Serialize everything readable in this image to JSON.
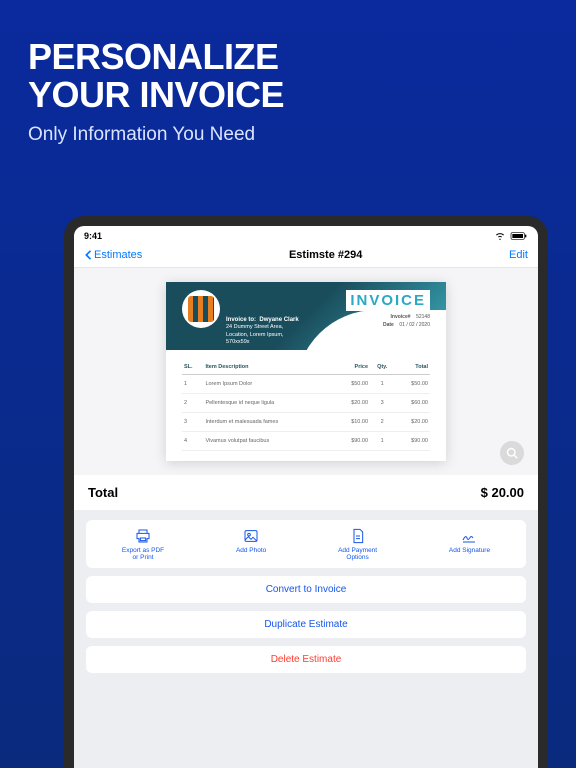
{
  "hero": {
    "title_line1": "PERSONALIZE",
    "title_line2": "YOUR INVOICE",
    "subtitle": "Only Information You Need"
  },
  "statusbar": {
    "time": "9:41"
  },
  "nav": {
    "back": "Estimates",
    "title": "Estimste #294",
    "edit": "Edit"
  },
  "doc": {
    "heading": "INVOICE",
    "to_label": "Invoice to:",
    "client": "Dwyane Clark",
    "addr1": "24 Dummy Street Area,",
    "addr2": "Location, Lorem Ipsum,",
    "addr3": "570xx59x",
    "num_label": "Invoice#",
    "num": "52148",
    "date_label": "Date",
    "date": "01 / 02 / 2020",
    "cols": {
      "sl": "SL.",
      "desc": "Item Description",
      "price": "Price",
      "qty": "Qty.",
      "total": "Total"
    },
    "rows": [
      {
        "sl": "1",
        "desc": "Lorem Ipsum Dolor",
        "price": "$50.00",
        "qty": "1",
        "total": "$50.00"
      },
      {
        "sl": "2",
        "desc": "Pellentesque id neque ligula",
        "price": "$20.00",
        "qty": "3",
        "total": "$60.00"
      },
      {
        "sl": "3",
        "desc": "Interdum et malesuada fames",
        "price": "$10.00",
        "qty": "2",
        "total": "$20.00"
      },
      {
        "sl": "4",
        "desc": "Vivamus volutpat faucibus",
        "price": "$90.00",
        "qty": "1",
        "total": "$90.00"
      }
    ]
  },
  "total": {
    "label": "Total",
    "value": "$ 20.00"
  },
  "actions": {
    "export": "Export as PDF\nor Print",
    "photo": "Add Photo",
    "payment": "Add Payment\nOptions",
    "signature": "Add Signature",
    "convert": "Convert to Invoice",
    "duplicate": "Duplicate Estimate",
    "delete": "Delete Estimate"
  }
}
